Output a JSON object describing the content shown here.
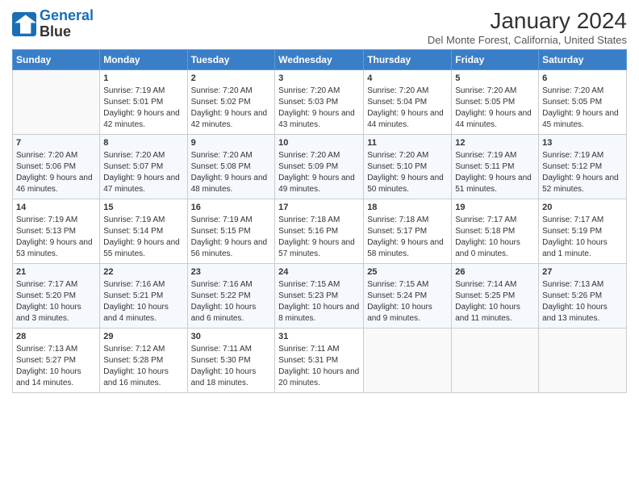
{
  "header": {
    "logo_line1": "General",
    "logo_line2": "Blue",
    "title": "January 2024",
    "subtitle": "Del Monte Forest, California, United States"
  },
  "days_of_week": [
    "Sunday",
    "Monday",
    "Tuesday",
    "Wednesday",
    "Thursday",
    "Friday",
    "Saturday"
  ],
  "weeks": [
    [
      {
        "day": "",
        "sunrise": "",
        "sunset": "",
        "daylight": ""
      },
      {
        "day": "1",
        "sunrise": "Sunrise: 7:19 AM",
        "sunset": "Sunset: 5:01 PM",
        "daylight": "Daylight: 9 hours and 42 minutes."
      },
      {
        "day": "2",
        "sunrise": "Sunrise: 7:20 AM",
        "sunset": "Sunset: 5:02 PM",
        "daylight": "Daylight: 9 hours and 42 minutes."
      },
      {
        "day": "3",
        "sunrise": "Sunrise: 7:20 AM",
        "sunset": "Sunset: 5:03 PM",
        "daylight": "Daylight: 9 hours and 43 minutes."
      },
      {
        "day": "4",
        "sunrise": "Sunrise: 7:20 AM",
        "sunset": "Sunset: 5:04 PM",
        "daylight": "Daylight: 9 hours and 44 minutes."
      },
      {
        "day": "5",
        "sunrise": "Sunrise: 7:20 AM",
        "sunset": "Sunset: 5:05 PM",
        "daylight": "Daylight: 9 hours and 44 minutes."
      },
      {
        "day": "6",
        "sunrise": "Sunrise: 7:20 AM",
        "sunset": "Sunset: 5:05 PM",
        "daylight": "Daylight: 9 hours and 45 minutes."
      }
    ],
    [
      {
        "day": "7",
        "sunrise": "Sunrise: 7:20 AM",
        "sunset": "Sunset: 5:06 PM",
        "daylight": "Daylight: 9 hours and 46 minutes."
      },
      {
        "day": "8",
        "sunrise": "Sunrise: 7:20 AM",
        "sunset": "Sunset: 5:07 PM",
        "daylight": "Daylight: 9 hours and 47 minutes."
      },
      {
        "day": "9",
        "sunrise": "Sunrise: 7:20 AM",
        "sunset": "Sunset: 5:08 PM",
        "daylight": "Daylight: 9 hours and 48 minutes."
      },
      {
        "day": "10",
        "sunrise": "Sunrise: 7:20 AM",
        "sunset": "Sunset: 5:09 PM",
        "daylight": "Daylight: 9 hours and 49 minutes."
      },
      {
        "day": "11",
        "sunrise": "Sunrise: 7:20 AM",
        "sunset": "Sunset: 5:10 PM",
        "daylight": "Daylight: 9 hours and 50 minutes."
      },
      {
        "day": "12",
        "sunrise": "Sunrise: 7:19 AM",
        "sunset": "Sunset: 5:11 PM",
        "daylight": "Daylight: 9 hours and 51 minutes."
      },
      {
        "day": "13",
        "sunrise": "Sunrise: 7:19 AM",
        "sunset": "Sunset: 5:12 PM",
        "daylight": "Daylight: 9 hours and 52 minutes."
      }
    ],
    [
      {
        "day": "14",
        "sunrise": "Sunrise: 7:19 AM",
        "sunset": "Sunset: 5:13 PM",
        "daylight": "Daylight: 9 hours and 53 minutes."
      },
      {
        "day": "15",
        "sunrise": "Sunrise: 7:19 AM",
        "sunset": "Sunset: 5:14 PM",
        "daylight": "Daylight: 9 hours and 55 minutes."
      },
      {
        "day": "16",
        "sunrise": "Sunrise: 7:19 AM",
        "sunset": "Sunset: 5:15 PM",
        "daylight": "Daylight: 9 hours and 56 minutes."
      },
      {
        "day": "17",
        "sunrise": "Sunrise: 7:18 AM",
        "sunset": "Sunset: 5:16 PM",
        "daylight": "Daylight: 9 hours and 57 minutes."
      },
      {
        "day": "18",
        "sunrise": "Sunrise: 7:18 AM",
        "sunset": "Sunset: 5:17 PM",
        "daylight": "Daylight: 9 hours and 58 minutes."
      },
      {
        "day": "19",
        "sunrise": "Sunrise: 7:17 AM",
        "sunset": "Sunset: 5:18 PM",
        "daylight": "Daylight: 10 hours and 0 minutes."
      },
      {
        "day": "20",
        "sunrise": "Sunrise: 7:17 AM",
        "sunset": "Sunset: 5:19 PM",
        "daylight": "Daylight: 10 hours and 1 minute."
      }
    ],
    [
      {
        "day": "21",
        "sunrise": "Sunrise: 7:17 AM",
        "sunset": "Sunset: 5:20 PM",
        "daylight": "Daylight: 10 hours and 3 minutes."
      },
      {
        "day": "22",
        "sunrise": "Sunrise: 7:16 AM",
        "sunset": "Sunset: 5:21 PM",
        "daylight": "Daylight: 10 hours and 4 minutes."
      },
      {
        "day": "23",
        "sunrise": "Sunrise: 7:16 AM",
        "sunset": "Sunset: 5:22 PM",
        "daylight": "Daylight: 10 hours and 6 minutes."
      },
      {
        "day": "24",
        "sunrise": "Sunrise: 7:15 AM",
        "sunset": "Sunset: 5:23 PM",
        "daylight": "Daylight: 10 hours and 8 minutes."
      },
      {
        "day": "25",
        "sunrise": "Sunrise: 7:15 AM",
        "sunset": "Sunset: 5:24 PM",
        "daylight": "Daylight: 10 hours and 9 minutes."
      },
      {
        "day": "26",
        "sunrise": "Sunrise: 7:14 AM",
        "sunset": "Sunset: 5:25 PM",
        "daylight": "Daylight: 10 hours and 11 minutes."
      },
      {
        "day": "27",
        "sunrise": "Sunrise: 7:13 AM",
        "sunset": "Sunset: 5:26 PM",
        "daylight": "Daylight: 10 hours and 13 minutes."
      }
    ],
    [
      {
        "day": "28",
        "sunrise": "Sunrise: 7:13 AM",
        "sunset": "Sunset: 5:27 PM",
        "daylight": "Daylight: 10 hours and 14 minutes."
      },
      {
        "day": "29",
        "sunrise": "Sunrise: 7:12 AM",
        "sunset": "Sunset: 5:28 PM",
        "daylight": "Daylight: 10 hours and 16 minutes."
      },
      {
        "day": "30",
        "sunrise": "Sunrise: 7:11 AM",
        "sunset": "Sunset: 5:30 PM",
        "daylight": "Daylight: 10 hours and 18 minutes."
      },
      {
        "day": "31",
        "sunrise": "Sunrise: 7:11 AM",
        "sunset": "Sunset: 5:31 PM",
        "daylight": "Daylight: 10 hours and 20 minutes."
      },
      {
        "day": "",
        "sunrise": "",
        "sunset": "",
        "daylight": ""
      },
      {
        "day": "",
        "sunrise": "",
        "sunset": "",
        "daylight": ""
      },
      {
        "day": "",
        "sunrise": "",
        "sunset": "",
        "daylight": ""
      }
    ]
  ]
}
